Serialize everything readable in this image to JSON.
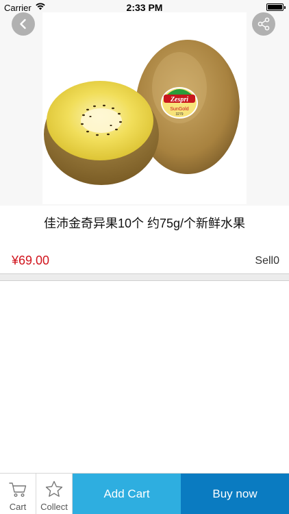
{
  "status_bar": {
    "carrier": "Carrier",
    "time": "2:33 PM",
    "battery_level": 1.0
  },
  "header": {
    "back_icon": "chevron-left-icon",
    "share_icon": "share-icon"
  },
  "product": {
    "image_label": "Zespri SunGold",
    "title": "佳沛金奇异果10个 约75g/个新鲜水果",
    "price": "¥69.00",
    "sell_label": "Sell",
    "sell_count": "0"
  },
  "bottom_bar": {
    "cart_label": "Cart",
    "collect_label": "Collect",
    "add_cart_label": "Add Cart",
    "buy_now_label": "Buy now"
  },
  "colors": {
    "price": "#d0121b",
    "add_cart_bg": "#2eaee0",
    "buy_now_bg": "#0a7bc1"
  }
}
